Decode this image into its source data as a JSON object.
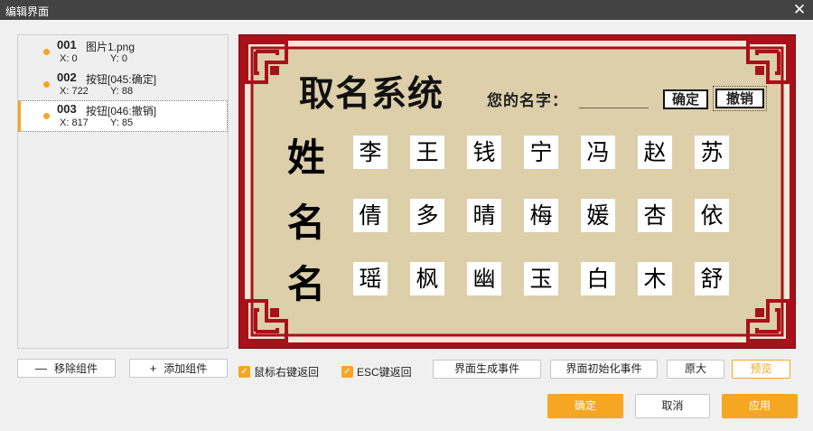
{
  "window": {
    "title": "编辑界面",
    "close_glyph": "✕"
  },
  "components": [
    {
      "num": "001",
      "label": "图片1.png",
      "x": "X:  0",
      "y": "Y:  0",
      "selected": false
    },
    {
      "num": "002",
      "label": "按钮[045:确定]",
      "x": "X:  722",
      "y": "Y:  88",
      "selected": false
    },
    {
      "num": "003",
      "label": "按钮[046:撤销]",
      "x": "X:  817",
      "y": "Y:  85",
      "selected": true
    }
  ],
  "preview": {
    "title": "取名系统",
    "prompt": "您的名字：",
    "underline": "________",
    "confirm_label": "确定",
    "undo_label": "撤销",
    "rows": [
      {
        "head": "姓",
        "chars": [
          "李",
          "王",
          "钱",
          "宁",
          "冯",
          "赵",
          "苏"
        ]
      },
      {
        "head": "名",
        "chars": [
          "倩",
          "多",
          "晴",
          "梅",
          "媛",
          "杏",
          "依"
        ]
      },
      {
        "head": "名",
        "chars": [
          "瑶",
          "枫",
          "幽",
          "玉",
          "白",
          "木",
          "舒"
        ]
      }
    ]
  },
  "toolbar": {
    "remove_icon": "—",
    "remove_label": "移除组件",
    "add_icon": "+",
    "add_label": "添加组件",
    "right_click_back": "鼠标右键返回",
    "esc_back": "ESC键返回",
    "gen_event": "界面生成事件",
    "init_event": "界面初始化事件",
    "original_size": "原大",
    "preview": "预览",
    "check_glyph": "✓"
  },
  "footer": {
    "ok": "确定",
    "cancel": "取消",
    "apply": "应用"
  },
  "colors": {
    "accent": "#f5a623",
    "frame_red": "#a8101a",
    "parchment": "#dccfa9",
    "titlebar": "#434343"
  }
}
